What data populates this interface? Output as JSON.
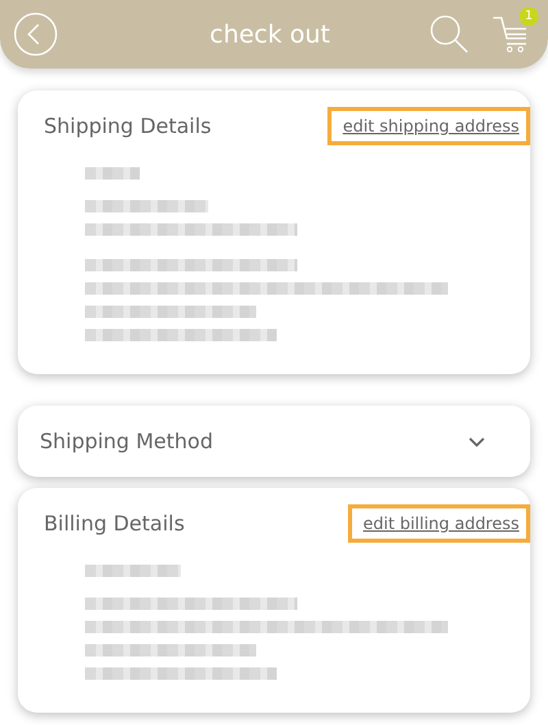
{
  "header": {
    "title": "check out",
    "cart_count": "1"
  },
  "sections": [
    {
      "kind": "details",
      "title": "Shipping Details",
      "link": "edit shipping address",
      "highlighted": true
    },
    {
      "kind": "collapsed",
      "title": "Shipping Method",
      "expanded": false
    },
    {
      "kind": "details",
      "title": "Billing Details",
      "link": "edit billing address",
      "highlighted": true
    }
  ]
}
